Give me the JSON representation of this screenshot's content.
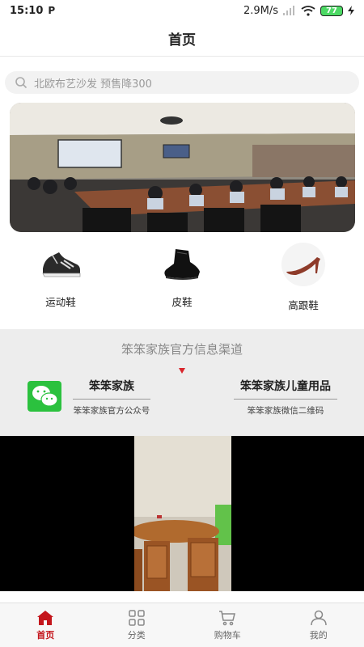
{
  "status_bar": {
    "time": "15:10",
    "app_badge": "P",
    "network_speed": "2.9M/s",
    "battery": "77"
  },
  "header": {
    "title": "首页"
  },
  "search": {
    "placeholder": "北欧布艺沙发 预售降300"
  },
  "banner": {
    "icon": "meeting-room-photo"
  },
  "categories": [
    {
      "label": "运动鞋",
      "icon": "sneaker-icon"
    },
    {
      "label": "皮鞋",
      "icon": "leather-shoe-icon"
    },
    {
      "label": "高跟鞋",
      "icon": "high-heel-icon"
    }
  ],
  "info": {
    "title": "笨笨家族官方信息渠道",
    "channels": [
      {
        "name": "笨笨家族",
        "desc": "笨笨家族官方公众号",
        "icon": "wechat-icon"
      },
      {
        "name": "笨笨家族儿童用品",
        "desc": "笨笨家族微信二维码"
      }
    ]
  },
  "tabs": [
    {
      "label": "首页",
      "icon": "home-icon",
      "active": true
    },
    {
      "label": "分类",
      "icon": "grid-icon",
      "active": false
    },
    {
      "label": "购物车",
      "icon": "cart-icon",
      "active": false
    },
    {
      "label": "我的",
      "icon": "user-icon",
      "active": false
    }
  ],
  "colors": {
    "accent": "#c4161c",
    "wechat": "#2bc13e",
    "battery": "#4cd964"
  }
}
